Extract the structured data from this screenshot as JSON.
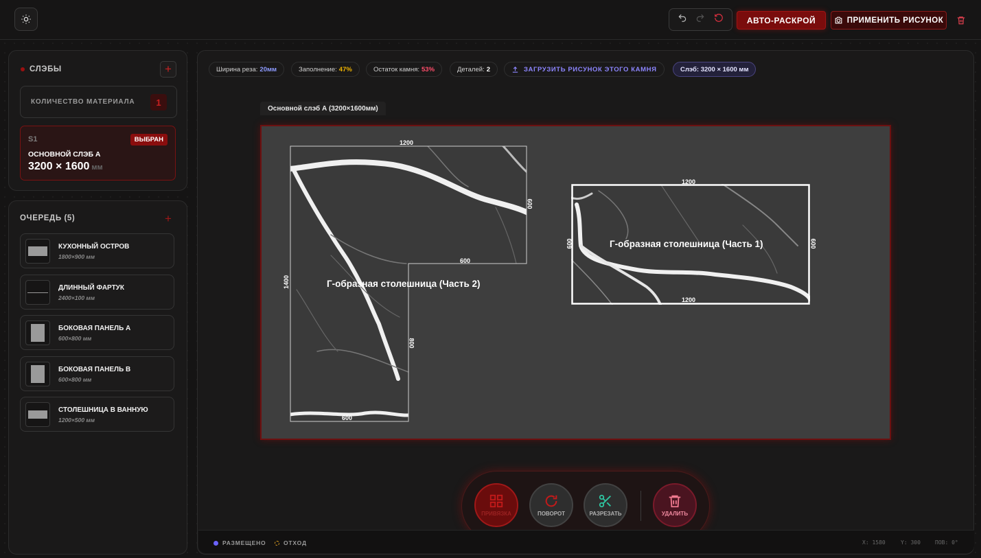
{
  "toolbar": {
    "auto_cut_label": "АВТО-РАСКРОЙ",
    "apply_image_label": "ПРИМЕНИТЬ РИСУНОК"
  },
  "sidebar": {
    "slabs_title": "СЛЭБЫ",
    "quantity_label": "КОЛИЧЕСТВО МАТЕРИАЛА",
    "quantity_value": "1",
    "slab": {
      "id": "S1",
      "badge": "ВЫБРАН",
      "name": "ОСНОВНОЙ СЛЭБ А",
      "size": "3200 × 1600",
      "unit": "мм"
    },
    "queue_title": "ОЧЕРЕДЬ (5)",
    "queue": [
      {
        "name": "КУХОННЫЙ ОСТРОВ",
        "dims": "1800×900 мм"
      },
      {
        "name": "ДЛИННЫЙ ФАРТУК",
        "dims": "2400×100 мм"
      },
      {
        "name": "БОКОВАЯ ПАНЕЛЬ А",
        "dims": "600×800 мм"
      },
      {
        "name": "БОКОВАЯ ПАНЕЛЬ B",
        "dims": "600×800 мм"
      },
      {
        "name": "СТОЛЕШНИЦА В ВАННУЮ",
        "dims": "1200×500 мм"
      }
    ]
  },
  "stats": {
    "kerf_label": "Ширина реза:",
    "kerf_value": "20мм",
    "fill_label": "Заполнение:",
    "fill_value": "47%",
    "remain_label": "Остаток камня:",
    "remain_value": "53%",
    "parts_label": "Деталей:",
    "parts_value": "2",
    "upload_label": "ЗАГРУЗИТЬ РИСУНОК ЭТОГО КАМНЯ",
    "slab_chip": "Слэб: 3200 × 1600 мм"
  },
  "canvas": {
    "slab_label": "Основной слэб А (3200×1600мм)",
    "part2": {
      "title": "Г-образная столешница (Часть 2)",
      "top": "1200",
      "right_top": "600",
      "inner_bottom": "600",
      "left": "1400",
      "right_lower": "800",
      "bottom": "600"
    },
    "part1": {
      "title": "Г-образная столешница (Часть 1)",
      "top": "1200",
      "bottom": "1200",
      "left": "600",
      "right": "600"
    }
  },
  "dock": {
    "snap": "ПРИВЯЗКА",
    "rotate": "ПОВОРОТ",
    "cut": "РАЗРЕЗАТЬ",
    "delete": "УДАЛИТЬ"
  },
  "status": {
    "placed": "РАЗМЕЩЕНО",
    "waste": "ОТХОД",
    "x": "X: 1580",
    "y": "Y: 300",
    "rot": "ПОВ: 0°"
  },
  "colors": {
    "accent": "#8a0d0d",
    "placed": "#6b63ff",
    "waste": "#e0a020",
    "fill": "#f0b400",
    "remain": "#ff4d6a",
    "kerf": "#8d9bff"
  }
}
